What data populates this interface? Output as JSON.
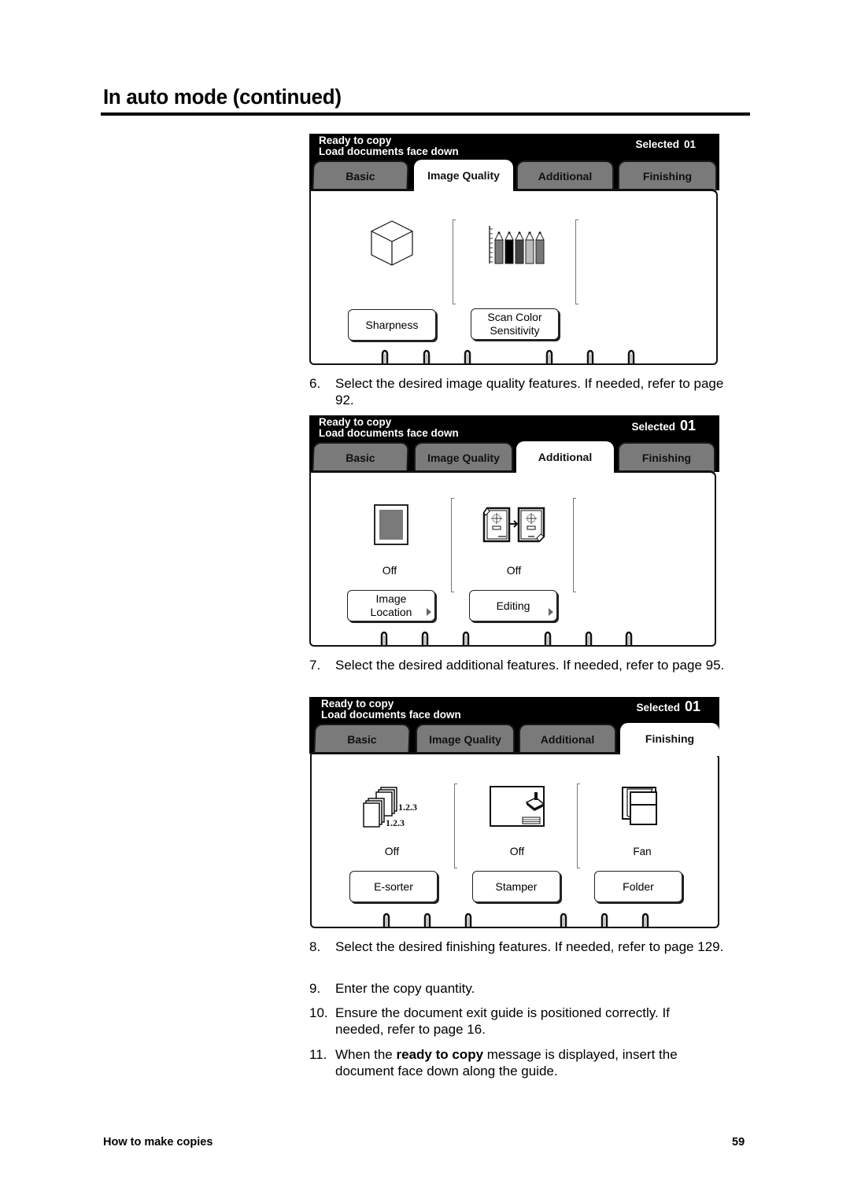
{
  "page": {
    "title": "In auto mode (continued)",
    "footer_section": "How to make copies",
    "page_number": "59"
  },
  "panels": [
    {
      "status_line_1": "Ready to copy",
      "status_line_2": "Load documents face down",
      "selected_label": "Selected",
      "selected_count": "01",
      "tabs": [
        "Basic",
        "Image Quality",
        "Additional",
        "Finishing"
      ],
      "active_tab": "Image Quality",
      "features": [
        {
          "icon": "cube-icon",
          "value": "",
          "button": "Sharpness",
          "has_submenu": false
        },
        {
          "icon": "color-pencils-icon",
          "value": "",
          "button": "Scan Color Sensitivity",
          "button_line_1": "Scan Color",
          "button_line_2": "Sensitivity",
          "has_submenu": false
        }
      ]
    },
    {
      "status_line_1": "Ready to copy",
      "status_line_2": "Load documents face down",
      "selected_label": "Selected",
      "selected_count": "01",
      "tabs": [
        "Basic",
        "Image Quality",
        "Additional",
        "Finishing"
      ],
      "active_tab": "Additional",
      "features": [
        {
          "icon": "image-location-icon",
          "value": "Off",
          "button": "Image Location",
          "button_line_1": "Image",
          "button_line_2": "Location",
          "has_submenu": true
        },
        {
          "icon": "editing-icon",
          "value": "Off",
          "button": "Editing",
          "has_submenu": true
        }
      ]
    },
    {
      "status_line_1": "Ready to copy",
      "status_line_2": "Load documents face down",
      "selected_label": "Selected",
      "selected_count": "01",
      "tabs": [
        "Basic",
        "Image Quality",
        "Additional",
        "Finishing"
      ],
      "active_tab": "Finishing",
      "features": [
        {
          "icon": "e-sorter-icon",
          "value": "Off",
          "button": "E-sorter",
          "icon_label": "1.2.3",
          "has_submenu": false
        },
        {
          "icon": "stamper-icon",
          "value": "Off",
          "button": "Stamper",
          "has_submenu": false
        },
        {
          "icon": "folder-icon",
          "value": "Fan",
          "button": "Folder",
          "has_submenu": false
        }
      ]
    }
  ],
  "steps": [
    {
      "number": "6.",
      "text": "Select the desired image quality features.  If needed, refer to page 92."
    },
    {
      "number": "7.",
      "text": "Select the desired additional features.  If needed, refer to page 95."
    },
    {
      "number": "8.",
      "text": "Select the desired finishing features.  If needed, refer to page 129."
    },
    {
      "number": "9.",
      "text": "Enter the copy quantity."
    },
    {
      "number": "10.",
      "text": "Ensure the document exit guide is positioned correctly.  If needed, refer to page 16."
    },
    {
      "number": "11.",
      "text_before": "When the ",
      "text_bold": "ready to copy",
      "text_after": " message is displayed, insert the document face down along the guide."
    }
  ]
}
